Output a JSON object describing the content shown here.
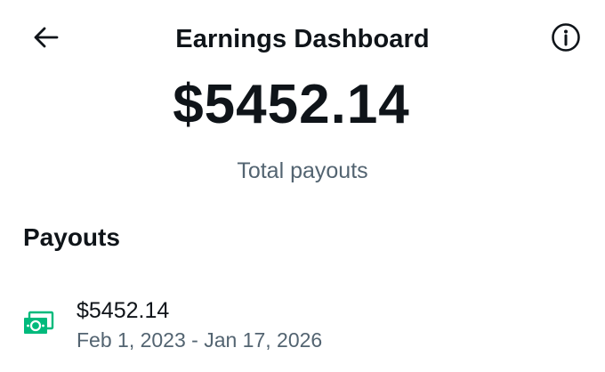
{
  "header": {
    "title": "Earnings Dashboard",
    "back_icon": "arrow-left-icon",
    "info_icon": "info-circle-icon"
  },
  "summary": {
    "total_amount": "$5452.14",
    "total_label": "Total payouts"
  },
  "payouts": {
    "section_title": "Payouts",
    "items": [
      {
        "icon": "cash-icon",
        "icon_color": "#00ba7c",
        "amount": "$5452.14",
        "date_range": "Feb 1, 2023 - Jan 17, 2026"
      }
    ]
  },
  "colors": {
    "text_primary": "#0f1419",
    "text_secondary": "#536471",
    "background": "#ffffff",
    "accent_green": "#00ba7c"
  }
}
